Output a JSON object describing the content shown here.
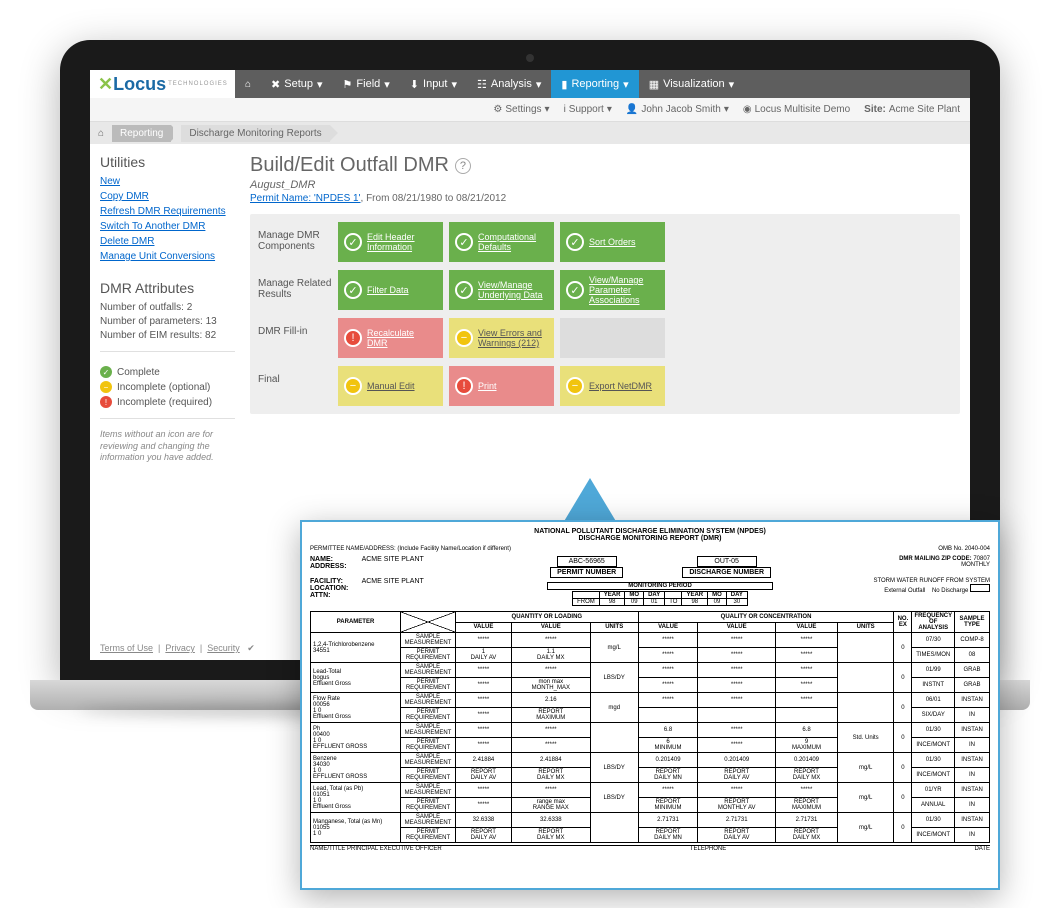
{
  "brand": {
    "name": "Locus",
    "sub": "TECHNOLOGIES"
  },
  "nav": {
    "home": "⌂",
    "setup": "Setup",
    "field": "Field",
    "input": "Input",
    "analysis": "Analysis",
    "reporting": "Reporting",
    "visualization": "Visualization"
  },
  "subnav": {
    "settings": "Settings",
    "support": "Support",
    "user": "John Jacob Smith",
    "demo": "Locus Multisite Demo",
    "site_label": "Site:",
    "site": "Acme Site Plant"
  },
  "crumbs": {
    "step1": "Reporting",
    "step2": "Discharge Monitoring Reports"
  },
  "sidebar": {
    "utilities_h": "Utilities",
    "links": {
      "new": "New",
      "copy": "Copy DMR",
      "refresh": "Refresh DMR Requirements",
      "switch": "Switch To Another DMR",
      "delete": "Delete DMR",
      "conv": "Manage Unit Conversions"
    },
    "attrs_h": "DMR Attributes",
    "attrs": {
      "outfalls": "Number of outfalls: 2",
      "params": "Number of parameters: 13",
      "eim": "Number of EIM results: 82"
    },
    "legend": {
      "complete": "Complete",
      "inc_opt": "Incomplete (optional)",
      "inc_req": "Incomplete (required)"
    },
    "note": "Items without an icon are for reviewing and changing the information you have added."
  },
  "content": {
    "title": "Build/Edit Outfall DMR",
    "subtitle": "August_DMR",
    "permit_label": "Permit Name: 'NPDES 1'",
    "date_range": ", From 08/21/1980 to 08/21/2012",
    "rows": {
      "r1": "Manage DMR Components",
      "r2": "Manage Related Results",
      "r3": "DMR Fill-in",
      "r4": "Final"
    },
    "tiles": {
      "edit_header": "Edit Header Information",
      "comp_def": "Computational Defaults",
      "sort": "Sort Orders",
      "filter": "Filter Data",
      "view_under": "View/Manage Underlying Data",
      "view_param": "View/Manage Parameter Associations",
      "recalc": "Recalculate DMR",
      "errors": "View Errors and Warnings (212)",
      "manual": "Manual Edit",
      "print": "Print",
      "export": "Export NetDMR"
    }
  },
  "footer": {
    "terms": "Terms of Use",
    "privacy": "Privacy",
    "security": "Security"
  },
  "report": {
    "title1": "NATIONAL POLLUTANT DISCHARGE ELIMINATION SYSTEM (NPDES)",
    "title2": "DISCHARGE MONITORING REPORT (DMR)",
    "permittee_lbl": "PERMITTEE NAME/ADDRESS: (Include Facility Name/Location if different)",
    "name_lbl": "NAME:",
    "name": "ACME SITE PLANT",
    "addr_lbl": "ADDRESS:",
    "facility_lbl": "FACILITY:",
    "facility": "ACME SITE PLANT",
    "location_lbl": "LOCATION:",
    "attn_lbl": "ATTN:",
    "permit_num": "ABC-56965",
    "permit_num_lbl": "PERMIT NUMBER",
    "discharge_num": "OUT-05",
    "discharge_num_lbl": "DISCHARGE NUMBER",
    "omb": "OMB No. 2040-004",
    "zip_lbl": "DMR MAILING ZIP CODE:",
    "zip": "70807",
    "monthly": "MONTHLY",
    "storm": "STORM WATER RUNOFF FROM SYSTEM",
    "ext": "External Outfall",
    "nodis": "No Discharge",
    "mon_lbl": "MONITORING PERIOD",
    "from": "FROM",
    "to": "TO",
    "year": "YEAR",
    "mo": "MO",
    "day": "DAY",
    "from_y": "98",
    "from_m": "09",
    "from_d": "01",
    "to_y": "98",
    "to_m": "09",
    "to_d": "30",
    "param_h": "PARAMETER",
    "qty_h": "QUANTITY OR LOADING",
    "qual_h": "QUALITY OR CONCENTRATION",
    "noex": "NO. EX",
    "freq": "FREQUENCY OF ANALYSIS",
    "stype": "SAMPLE TYPE",
    "value": "VALUE",
    "units": "UNITS",
    "sm": "SAMPLE MEASUREMENT",
    "pr": "PERMIT REQUIREMENT",
    "rows": [
      {
        "name": "1,2,4-Trichlorobenzene",
        "code": "34551",
        "sub": "",
        "sm": [
          "*****",
          "*****",
          "mg/L",
          "*****",
          "*****",
          "*****",
          ""
        ],
        "pr": [
          "1\nDAILY AV",
          "1.1\nDAILY MX",
          "",
          "*****",
          "*****",
          "*****",
          ""
        ],
        "ex": "0",
        "fa": "07/30",
        "st": "COMP-8",
        "fa2": "TIMES/MON",
        "st2": "08"
      },
      {
        "name": "Lead-Total",
        "code": "bogus",
        "sub": "Effluent Gross",
        "sm": [
          "*****",
          "*****",
          "LBS/DY",
          "*****",
          "*****",
          "*****",
          ""
        ],
        "pr": [
          "*****",
          "mon max\nMONTH_MAX",
          "",
          "*****",
          "*****",
          "*****",
          ""
        ],
        "ex": "0",
        "fa": "01/99",
        "st": "GRAB",
        "fa2": "INSTNT",
        "st2": "GRAB"
      },
      {
        "name": "Flow Rate",
        "code": "00056",
        "sub": "1 0\nEffluent Gross",
        "sm": [
          "*****",
          "2.16",
          "mgd",
          "*****",
          "*****",
          "*****",
          ""
        ],
        "pr": [
          "*****",
          "REPORT\nMAXIMUM",
          "",
          "",
          "",
          "",
          ""
        ],
        "ex": "0",
        "fa": "06/01",
        "st": "INSTAN",
        "fa2": "SIX/DAY",
        "st2": "IN"
      },
      {
        "name": "Ph",
        "code": "00400",
        "sub": "1 0\nEFFLUENT GROSS",
        "sm": [
          "*****",
          "*****",
          "",
          "6.8",
          "*****",
          "6.8",
          "Std. Units"
        ],
        "pr": [
          "*****",
          "*****",
          "",
          "6\nMINIMUM",
          "*****",
          "9\nMAXIMUM",
          ""
        ],
        "ex": "0",
        "fa": "01/30",
        "st": "INSTAN",
        "fa2": "INCE/MONT",
        "st2": "IN"
      },
      {
        "name": "Benzene",
        "code": "34030",
        "sub": "1 0\nEFFLUENT GROSS",
        "sm": [
          "2.41884",
          "2.41884",
          "LBS/DY",
          "0.201409",
          "0.201409",
          "0.201409",
          "mg/L"
        ],
        "pr": [
          "REPORT\nDAILY AV",
          "REPORT\nDAILY MX",
          "",
          "REPORT\nDAILY MN",
          "REPORT\nDAILY AV",
          "REPORT\nDAILY MX",
          ""
        ],
        "ex": "0",
        "fa": "01/30",
        "st": "INSTAN",
        "fa2": "INCE/MONT",
        "st2": "IN"
      },
      {
        "name": "Lead, Total (as Pb)",
        "code": "01051",
        "sub": "1 0\nEffluent Gross",
        "sm": [
          "*****",
          "*****",
          "LBS/DY",
          "*****",
          "*****",
          "*****",
          "mg/L"
        ],
        "pr": [
          "*****",
          "range max\nRANGE MAX",
          "",
          "REPORT\nMINIMUM",
          "REPORT\nMONTHLY AV",
          "REPORT\nMAXIMUM",
          ""
        ],
        "ex": "0",
        "fa": "01/YR",
        "st": "INSTAN",
        "fa2": "ANNUAL",
        "st2": "IN"
      },
      {
        "name": "Manganese, Total (as Mn)",
        "code": "01055",
        "sub": "1 0",
        "sm": [
          "32.6338",
          "32.6338",
          "",
          "2.71731",
          "2.71731",
          "2.71731",
          "mg/L"
        ],
        "pr": [
          "REPORT\nDAILY AV",
          "REPORT\nDAILY MX",
          "",
          "REPORT\nDAILY MN",
          "REPORT\nDAILY AV",
          "REPORT\nDAILY MX",
          ""
        ],
        "ex": "0",
        "fa": "01/30",
        "st": "INSTAN",
        "fa2": "INCE/MONT",
        "st2": "IN"
      }
    ],
    "cert": "NAME/TITLE PRINCIPAL EXECUTIVE OFFICER",
    "tel": "TELEPHONE",
    "date": "DATE"
  }
}
